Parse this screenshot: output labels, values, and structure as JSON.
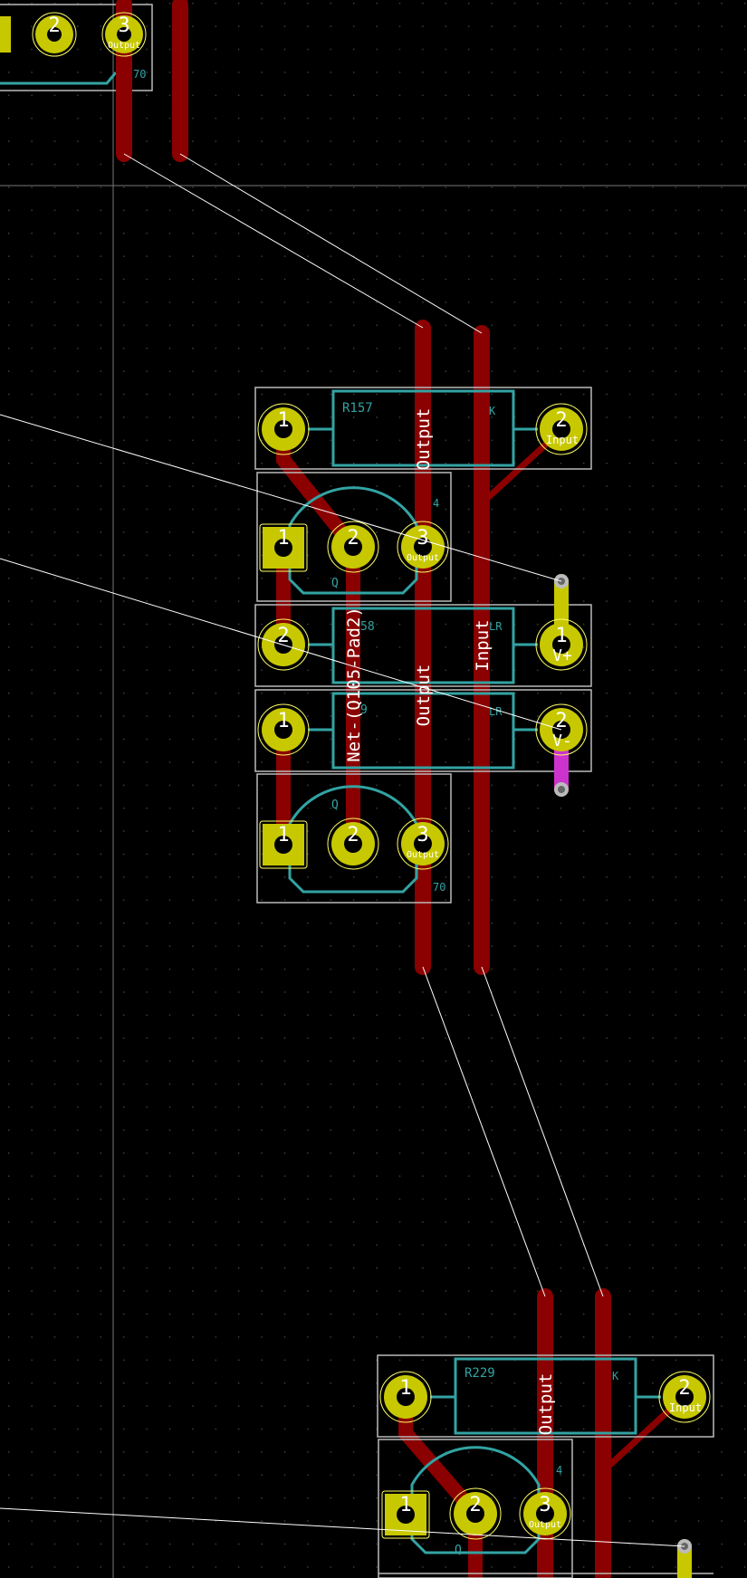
{
  "app": {
    "view": "PCB layout editor canvas"
  },
  "colors": {
    "background": "#000000",
    "grid": "#3c3c3c",
    "track": "#8b0000",
    "pad": "#c8c800",
    "pad_ring": "#ffff66",
    "pad_hole": "#000000",
    "silkscreen": "#33a3a3",
    "courtyard": "#bbbbbb",
    "ratsnest": "#ffffff",
    "magenta_segment": "#cc33cc",
    "net_label": "#ffffff"
  },
  "footprints": {
    "r157": {
      "ref": "R157",
      "pad1": "1",
      "pad2": "2",
      "pad2_net": "Input",
      "value_tail": "K"
    },
    "q_mid_upper": {
      "ref_visible": "Q",
      "pad1": "1",
      "pad2": "2",
      "pad3": "3",
      "pad3_net": "Output",
      "value_tail": "4"
    },
    "r158": {
      "ref_visible": "58",
      "pad1": "2",
      "pad2": "1",
      "pad2_net": "V+",
      "value_tail": "LR"
    },
    "r159": {
      "ref_visible": "9",
      "pad1": "1",
      "pad2": "2",
      "pad2_net": "V-",
      "value_tail": "LR"
    },
    "q_mid_lower": {
      "ref_visible": "Q",
      "pad1": "1",
      "pad2": "2",
      "pad3": "3",
      "pad3_net": "Output",
      "value_tail": "70"
    },
    "q_top": {
      "pad2": "2",
      "pad3": "3",
      "pad3_net": "Output",
      "value_tail": "70"
    },
    "r229": {
      "ref": "R229",
      "pad1": "1",
      "pad2": "2",
      "pad2_net": "Input",
      "value_tail": "K"
    },
    "q_bottom": {
      "ref_visible": "Q",
      "pad1": "1",
      "pad2": "2",
      "pad3": "3",
      "pad3_net": "Output",
      "value_tail": "4"
    }
  },
  "track_labels": {
    "output_upper": "Output",
    "output_lower": "Output",
    "input_mid": "Input",
    "net_q105": "Net-(Q105-Pad2)",
    "output_bottom": "Output"
  }
}
